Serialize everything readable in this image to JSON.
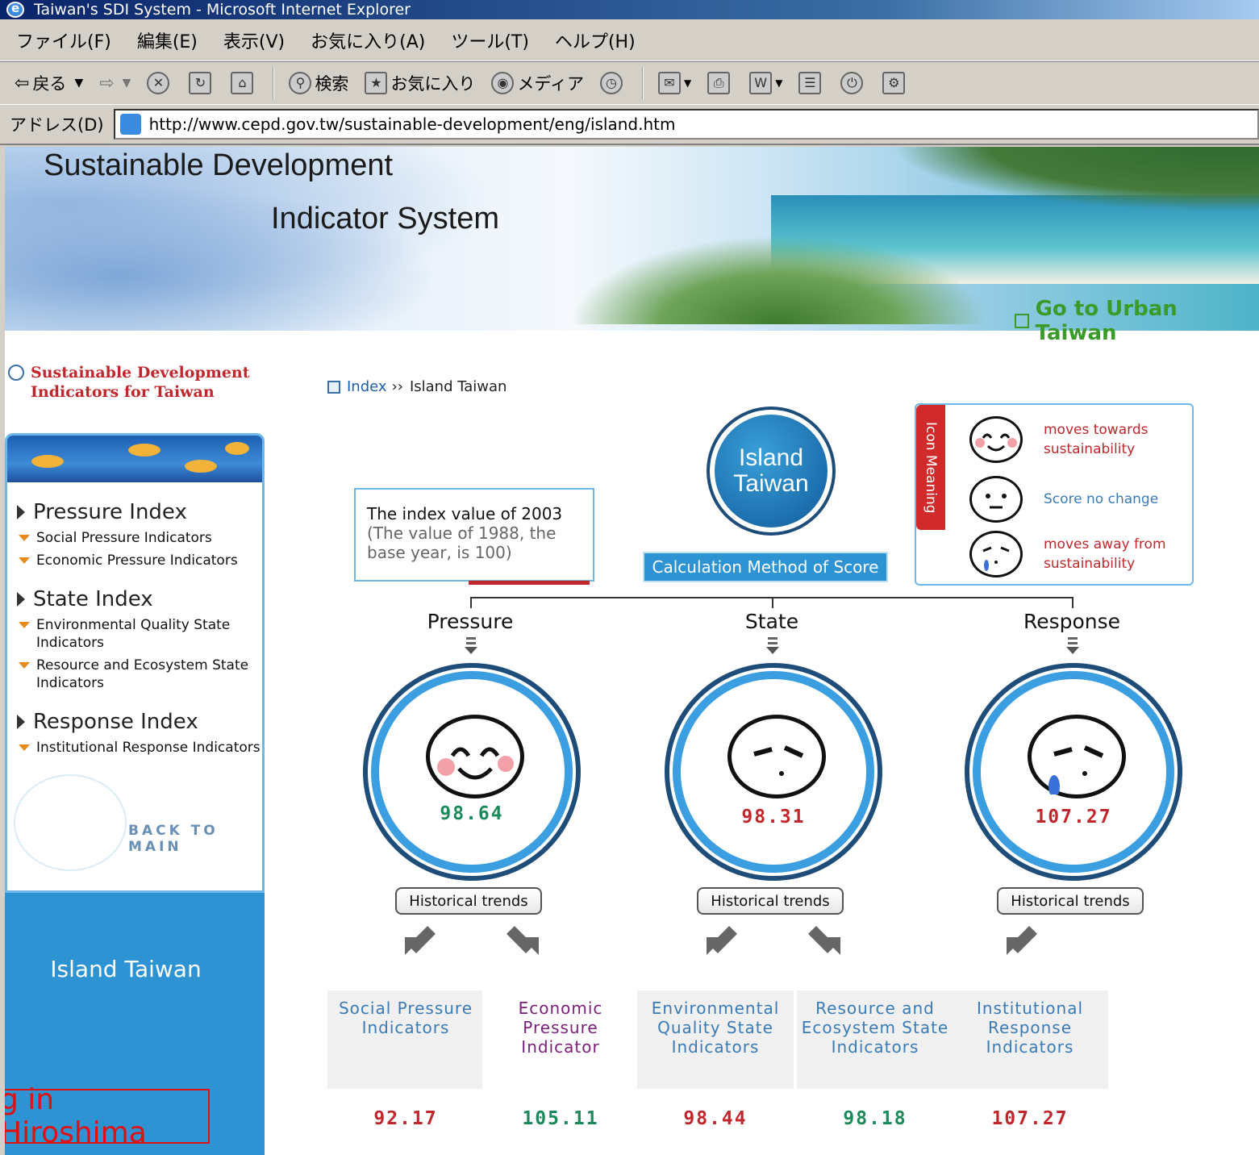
{
  "window": {
    "title": "Taiwan's SDI System - Microsoft Internet Explorer"
  },
  "menu": [
    "ファイル(F)",
    "編集(E)",
    "表示(V)",
    "お気に入り(A)",
    "ツール(T)",
    "ヘルプ(H)"
  ],
  "toolbar": {
    "back": "戻る",
    "search": "検索",
    "favorites": "お気に入り",
    "media": "メディア"
  },
  "address": {
    "label": "アドレス(D)",
    "url": "http://www.cepd.gov.tw/sustainable-development/eng/island.htm"
  },
  "banner": {
    "title_line1": "Sustainable Development",
    "title_line2": "Indicator System",
    "urban_link": "Go to Urban Taiwan"
  },
  "sidebar": {
    "heading": "Sustainable Development Indicators for Taiwan",
    "sections": [
      {
        "title": "Pressure Index",
        "items": [
          "Social Pressure Indicators",
          "Economic Pressure Indicators"
        ]
      },
      {
        "title": "State Index",
        "items": [
          "Environmental Quality State Indicators",
          "Resource and Ecosystem State Indicators"
        ]
      },
      {
        "title": "Response Index",
        "items": [
          "Institutional Response Indicators"
        ]
      }
    ],
    "back_to_main": "BACK TO MAIN",
    "island_label": "Island Taiwan"
  },
  "overlay_caption": "g in Hiroshima",
  "breadcrumb": {
    "index": "Index",
    "sep": "››",
    "current": "Island Taiwan"
  },
  "index_box": {
    "line1": "The index value of 2003",
    "line2": "(The value of 1988, the base year, is 100)"
  },
  "island_badge": {
    "line1": "Island",
    "line2": "Taiwan"
  },
  "calc_button": "Calculation Method of Score",
  "legend": {
    "tab": "Icon Meaning",
    "rows": [
      {
        "text": "moves towards sustainability",
        "color": "#c0272d"
      },
      {
        "text": "Score no change",
        "color": "#3a7ab5"
      },
      {
        "text": "moves away from sustainability",
        "color": "#c0272d"
      }
    ]
  },
  "columns": [
    {
      "head": "Pressure",
      "score": "98.64",
      "score_color": "#1a8a5a",
      "face": "happy",
      "hist": "Historical trends"
    },
    {
      "head": "State",
      "score": "98.31",
      "score_color": "#c0272d",
      "face": "sad",
      "hist": "Historical trends"
    },
    {
      "head": "Response",
      "score": "107.27",
      "score_color": "#c0272d",
      "face": "sad-tear",
      "hist": "Historical trends"
    }
  ],
  "sub_indicators": [
    {
      "label": "Social Pressure Indicators",
      "value": "92.17",
      "label_color": "#3a7ab5",
      "value_color": "#c0272d"
    },
    {
      "label": "Economic Pressure Indicator",
      "value": "105.11",
      "label_color": "#7a1f78",
      "value_color": "#1a8a5a"
    },
    {
      "label": "Environmental Quality State Indicators",
      "value": "98.44",
      "label_color": "#3a7ab5",
      "value_color": "#c0272d"
    },
    {
      "label": "Resource and Ecosystem State Indicators",
      "value": "98.18",
      "label_color": "#3a7ab5",
      "value_color": "#1a8a5a"
    },
    {
      "label": "Institutional Response Indicators",
      "value": "107.27",
      "label_color": "#3a7ab5",
      "value_color": "#c0272d"
    }
  ]
}
